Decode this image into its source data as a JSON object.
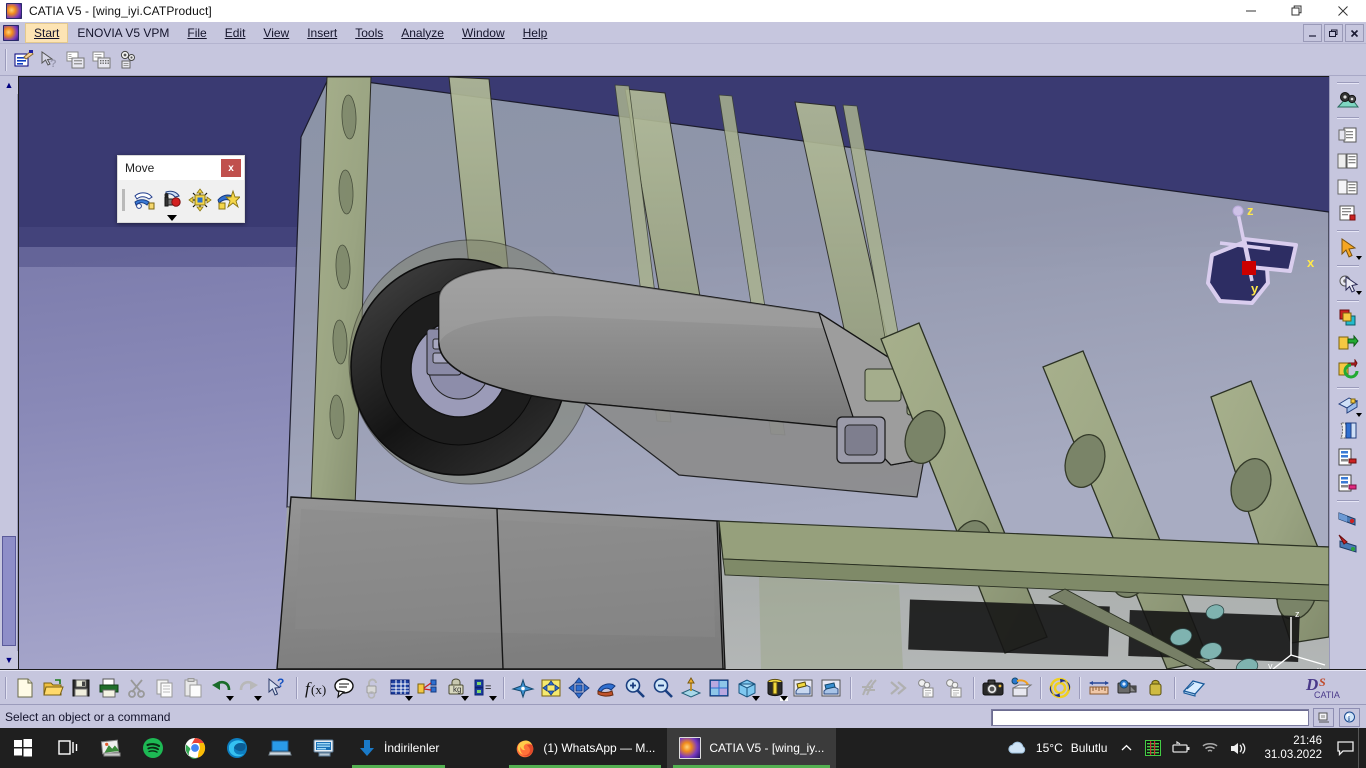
{
  "window": {
    "title": "CATIA V5 - [wing_iyi.CATProduct]",
    "app_icon": "catia-icon",
    "controls": {
      "minimize": "minimize-icon",
      "restore": "restore-icon",
      "close": "close-icon"
    }
  },
  "menubar": {
    "items": [
      {
        "label": "Start",
        "mnemonic": "S",
        "highlighted": true
      },
      {
        "label": "ENOVIA V5 VPM",
        "mnemonic": "",
        "highlighted": false
      },
      {
        "label": "File",
        "mnemonic": "F",
        "highlighted": false
      },
      {
        "label": "Edit",
        "mnemonic": "E",
        "highlighted": false
      },
      {
        "label": "View",
        "mnemonic": "V",
        "highlighted": false
      },
      {
        "label": "Insert",
        "mnemonic": "I",
        "highlighted": false
      },
      {
        "label": "Tools",
        "mnemonic": "T",
        "highlighted": false
      },
      {
        "label": "Analyze",
        "mnemonic": "A",
        "highlighted": false
      },
      {
        "label": "Window",
        "mnemonic": "W",
        "highlighted": false
      },
      {
        "label": "Help",
        "mnemonic": "H",
        "highlighted": false
      }
    ],
    "mdi_controls": [
      "minimize-document",
      "restore-document",
      "close-document"
    ]
  },
  "toolbar_top": {
    "icons": [
      "edit-properties-icon",
      "define-contextual-menu-icon",
      "manage-representations-icon",
      "generate-numbering-icon",
      "catalog-browser-icon"
    ]
  },
  "move_palette": {
    "title": "Move",
    "close_label": "x",
    "icons": [
      "manipulation-icon",
      "snap-icon",
      "smart-move-icon",
      "explode-icon"
    ]
  },
  "viewport": {
    "compass": {
      "x_label": "x",
      "y_label": "y",
      "z_label": "z"
    },
    "axis_triad": {
      "x_label": "x",
      "y_label": "y",
      "z_label": "z"
    },
    "model": "aircraft-wing-assembly-ribs-spars"
  },
  "right_toolbar": {
    "icons": [
      "update-all-icon",
      "fit-all-in-icon",
      "normal-view-icon",
      "create-multi-view-icon",
      "named-views-icon",
      "select-arrow-icon",
      "select-tools-icon",
      "apply-material-icon",
      "catalog-icon",
      "import-icon",
      "export-icon",
      "measure-between-icon",
      "measure-item-icon",
      "sectioning-icon",
      "distance-analysis-icon",
      "clash-analysis-icon",
      "annotation-icon",
      "annotation2-icon"
    ]
  },
  "bottom_toolbar": {
    "icons": [
      "new-icon",
      "open-icon",
      "save-icon",
      "print-icon",
      "cut-icon",
      "copy-icon",
      "paste-icon",
      "undo-icon",
      "redo-icon",
      "whats-this-icon",
      "formula-icon",
      "comment-icon",
      "lock-unlock-icon",
      "design-table-icon",
      "constraint-icon",
      "measure-inertia-icon",
      "parameters-icon",
      "fly-mode-icon",
      "fit-all-in-icon",
      "pan-icon",
      "rotate-icon",
      "zoom-in-icon",
      "zoom-out-icon",
      "normal-view-icon",
      "multi-view-icon",
      "isometric-view-icon",
      "render-style-icon",
      "hide-show-icon",
      "swap-visible-space-icon",
      "cut-section-icon",
      "fast-multi-instantiation-icon",
      "catalog-browser-1-icon",
      "catalog-browser-2-icon",
      "capture-icon",
      "album-icon",
      "simulation-icon",
      "measure-item-icon",
      "measure-between-icon",
      "mass-properties-icon",
      "publication-icon"
    ]
  },
  "statusbar": {
    "message": "Select an object or a command",
    "command_value": "",
    "command_placeholder": "",
    "icons": [
      "power-input-icon",
      "help-info-icon"
    ]
  },
  "taskbar": {
    "start_label": "Start",
    "items": [
      {
        "id": "start",
        "icon": "windows-start-icon",
        "label": "",
        "pinned": true,
        "active": false,
        "running": false
      },
      {
        "id": "taskview",
        "icon": "task-view-icon",
        "label": "",
        "pinned": true,
        "active": false,
        "running": false
      },
      {
        "id": "photos",
        "icon": "photos-icon",
        "label": "",
        "pinned": true,
        "active": false,
        "running": false
      },
      {
        "id": "spotify",
        "icon": "spotify-icon",
        "label": "",
        "pinned": true,
        "active": false,
        "running": false
      },
      {
        "id": "chrome",
        "icon": "chrome-icon",
        "label": "",
        "pinned": true,
        "active": false,
        "running": false
      },
      {
        "id": "edge",
        "icon": "edge-icon",
        "label": "",
        "pinned": true,
        "active": false,
        "running": false
      },
      {
        "id": "remote",
        "icon": "remote-desktop-icon",
        "label": "",
        "pinned": true,
        "active": false,
        "running": false
      },
      {
        "id": "monitor",
        "icon": "system-monitor-icon",
        "label": "",
        "pinned": true,
        "active": false,
        "running": false
      },
      {
        "id": "downloads",
        "icon": "downloads-arrow-icon",
        "label": "İndirilenler",
        "pinned": false,
        "active": false,
        "running": true
      },
      {
        "id": "whatsapp",
        "icon": "firefox-icon",
        "label": "(1) WhatsApp — M...",
        "pinned": false,
        "active": false,
        "running": true
      },
      {
        "id": "catia",
        "icon": "catia-icon",
        "label": "CATIA V5 - [wing_iy...",
        "pinned": false,
        "active": true,
        "running": true
      }
    ],
    "tray": {
      "weather_temp": "15°C",
      "weather_text": "Bulutlu",
      "weather_icon": "cloud-icon",
      "chevron": "show-hidden-icons-icon",
      "icons": [
        "equalizer-icon",
        "battery-icon",
        "wifi-icon",
        "volume-icon"
      ],
      "time": "21:46",
      "date": "31.03.2022",
      "action_center": "notification-icon"
    }
  },
  "colors": {
    "titlebar_bg": "#ffffff",
    "menu_bg": "#c6c6de",
    "toolbar_bg": "#c6c6de",
    "viewport_top": "#33336b",
    "viewport_bottom": "#b6b6d6",
    "rib_green": "#9aa482",
    "metal_gray": "#8e8e8e",
    "taskbar_bg": "#1f1f1f",
    "accent_green": "#53b051",
    "move_close_red": "#c0504d",
    "compass_label": "#ffe84a"
  }
}
